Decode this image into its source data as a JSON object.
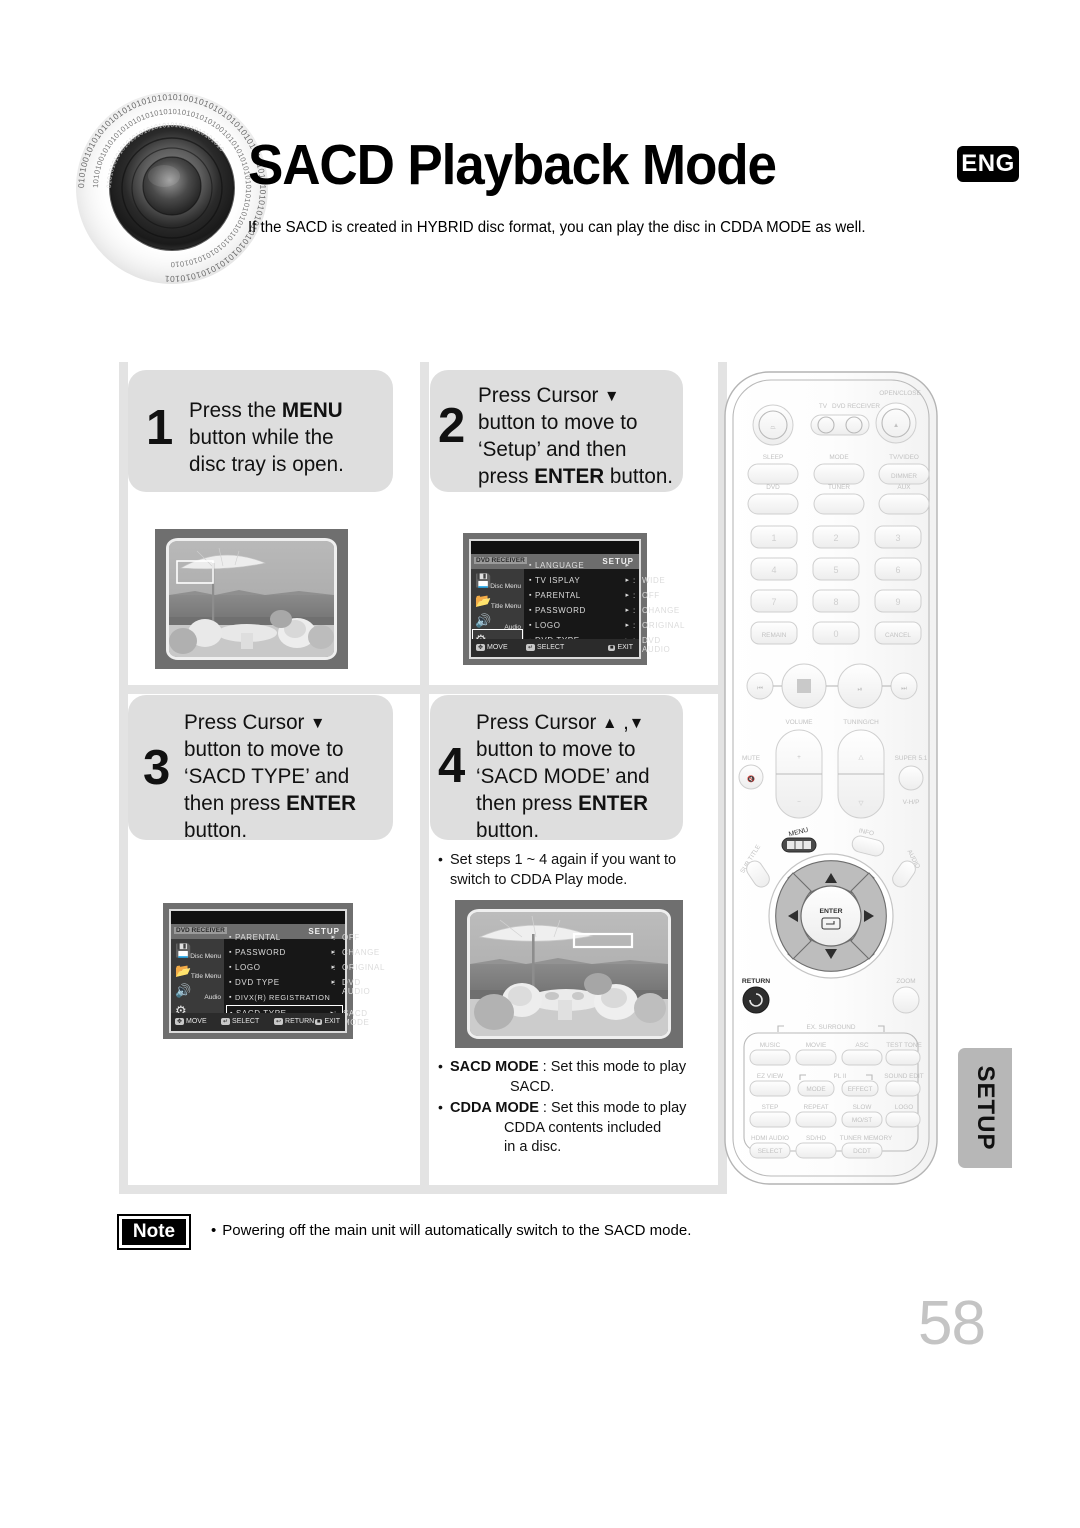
{
  "header": {
    "title": "SACD Playback Mode",
    "lang_badge": "ENG",
    "subtitle": "If the SACD is created in HYBRID disc format, you can play the disc in CDDA MODE as well."
  },
  "steps": [
    {
      "num": "1",
      "lines": [
        [
          {
            "t": "Press the "
          },
          {
            "t": "MENU",
            "b": true
          }
        ],
        [
          {
            "t": "button while the"
          }
        ],
        [
          {
            "t": "disc tray is open."
          }
        ]
      ]
    },
    {
      "num": "2",
      "lines": [
        [
          {
            "t": "Press Cursor "
          },
          {
            "t": "▼",
            "tri": true
          }
        ],
        [
          {
            "t": "button to move to"
          }
        ],
        [
          {
            "t": "‘Setup’ and then"
          }
        ],
        [
          {
            "t": "press "
          },
          {
            "t": "ENTER",
            "b": true
          },
          {
            "t": " button."
          }
        ]
      ]
    },
    {
      "num": "3",
      "lines": [
        [
          {
            "t": "Press Cursor "
          },
          {
            "t": "▼",
            "tri": true
          }
        ],
        [
          {
            "t": "button to move to"
          }
        ],
        [
          {
            "t": "‘SACD TYPE’ and"
          }
        ],
        [
          {
            "t": "then press "
          },
          {
            "t": "ENTER",
            "b": true
          }
        ],
        [
          {
            "t": "button."
          }
        ]
      ]
    },
    {
      "num": "4",
      "lines": [
        [
          {
            "t": "Press Cursor "
          },
          {
            "t": "▲",
            "tri": true
          },
          {
            "t": " ,"
          },
          {
            "t": "▼",
            "tri": true
          }
        ],
        [
          {
            "t": "button to move to"
          }
        ],
        [
          {
            "t": "‘SACD MODE’ and"
          }
        ],
        [
          {
            "t": "then press "
          },
          {
            "t": "ENTER",
            "b": true
          }
        ],
        [
          {
            "t": "button."
          }
        ]
      ]
    }
  ],
  "osd1": {
    "title": "SETUP",
    "tag": "DVD RECEIVER",
    "side": [
      {
        "icon": "disc-menu-icon",
        "label": "Disc Menu"
      },
      {
        "icon": "title-menu-icon",
        "label": "Title Menu"
      },
      {
        "icon": "audio-icon",
        "label": "Audio"
      },
      {
        "icon": "setup-gear-icon",
        "label": "Setup",
        "selected": true
      }
    ],
    "rows": [
      {
        "key": "LANGUAGE",
        "value": "",
        "arrow": "▸"
      },
      {
        "key": "TV  ISPLAY",
        "value": "WIDE",
        "arrow": "▸"
      },
      {
        "key": "PARENTAL",
        "value": "OFF",
        "arrow": "▸"
      },
      {
        "key": "PASSWORD",
        "value": "CHANGE",
        "arrow": "▸"
      },
      {
        "key": "LOGO",
        "value": "ORIGINAL",
        "arrow": "▸"
      },
      {
        "key": "DVD TYPE",
        "value": "DVD  AUDIO",
        "arrow": "▸"
      }
    ],
    "footer": [
      {
        "badge": "✥",
        "label": "MOVE"
      },
      {
        "badge": "↵",
        "label": "SELECT"
      },
      {
        "badge": "■",
        "label": "EXIT"
      }
    ]
  },
  "osd2": {
    "title": "SETUP",
    "tag": "DVD RECEIVER",
    "side": [
      {
        "icon": "disc-menu-icon",
        "label": "Disc Menu"
      },
      {
        "icon": "title-menu-icon",
        "label": "Title Menu"
      },
      {
        "icon": "audio-icon",
        "label": "Audio"
      },
      {
        "icon": "setup-gear-icon",
        "label": "Setup",
        "selected": true
      }
    ],
    "rows": [
      {
        "key": "PARENTAL",
        "value": "OFF",
        "arrow": "▸"
      },
      {
        "key": "PASSWORD",
        "value": "CHANGE",
        "arrow": "▸"
      },
      {
        "key": "LOGO",
        "value": "ORIGINAL",
        "arrow": "▸"
      },
      {
        "key": "DVD TYPE",
        "value": "DVD  AUDIO",
        "arrow": "▸"
      },
      {
        "key": "DIVX(R) REGISTRATION",
        "value": "",
        "arrow": ""
      },
      {
        "key": "SACD TYPE",
        "value": "SACD MODE",
        "arrow": "▸",
        "highlight": true
      }
    ],
    "footer": [
      {
        "badge": "✥",
        "label": "MOVE"
      },
      {
        "badge": "↵",
        "label": "SELECT"
      },
      {
        "badge": "↩",
        "label": "RETURN"
      },
      {
        "badge": "■",
        "label": "EXIT"
      }
    ]
  },
  "note_step4": {
    "line1": "Set steps 1 ~ 4 again if you want to",
    "line2": "switch to CDDA Play mode."
  },
  "mode_notes": {
    "sacd_label": "SACD MODE",
    "sacd_sep": " : Set this mode to play",
    "sacd_line2": "SACD.",
    "cdda_label": "CDDA MODE",
    "cdda_sep": " : Set this mode to play",
    "cdda_line2": "CDDA contents included",
    "cdda_line3": "in a disc."
  },
  "note": {
    "badge": "Note",
    "text": "Powering off the main unit will automatically switch to the SACD mode."
  },
  "setup_tab": "SETUP",
  "page_number": "58",
  "remote": {
    "labels": {
      "open_close": "OPEN/CLOSE",
      "tv": "TV",
      "dvd_receiver": "DVD RECEIVER",
      "sleep": "SLEEP",
      "mode": "MODE",
      "tv_video": "TV/VIDEO",
      "dimmer": "DIMMER",
      "dvd": "DVD",
      "tuner": "TUNER",
      "aux": "AUX",
      "remain": "REMAIN",
      "cancel": "CANCEL",
      "volume": "VOLUME",
      "tuning_ch": "TUNING/CH",
      "mute": "MUTE",
      "super51": "SUPER 5.1",
      "vhp": "V-H/P",
      "menu": "MENU",
      "info": "INFO",
      "subtitle": "SUB TITLE",
      "audio": "AUDIO",
      "enter": "ENTER",
      "return": "RETURN",
      "zoom": "ZOOM",
      "ex_surround": "EX. SURROUND",
      "music": "MUSIC",
      "movie": "MOVIE",
      "asc": "ASC",
      "test_tone": "TEST TONE",
      "ez_view": "EZ VIEW",
      "pl2": "PL II",
      "pl2_mode": "MODE",
      "effect": "EFFECT",
      "sound_edit": "SOUND EDIT",
      "step": "STEP",
      "repeat": "REPEAT",
      "slow": "SLOW",
      "most": "MO/ST",
      "logo": "LOGO",
      "hdmi_audio": "HDMI AUDIO",
      "select": "SELECT",
      "sd_hd": "SD/HD",
      "tuner_memory": "TUNER MEMORY",
      "dcdt": "DCDT"
    },
    "numbers": [
      "1",
      "2",
      "3",
      "4",
      "5",
      "6",
      "7",
      "8",
      "9"
    ],
    "zero": "0"
  },
  "colors": {
    "bubble_bg": "#dedede",
    "divider": "#e3e3e3",
    "osd_frame": "#6f6f6f",
    "tab_bg": "#b7b7b7",
    "page_number": "#c4c4c4"
  }
}
